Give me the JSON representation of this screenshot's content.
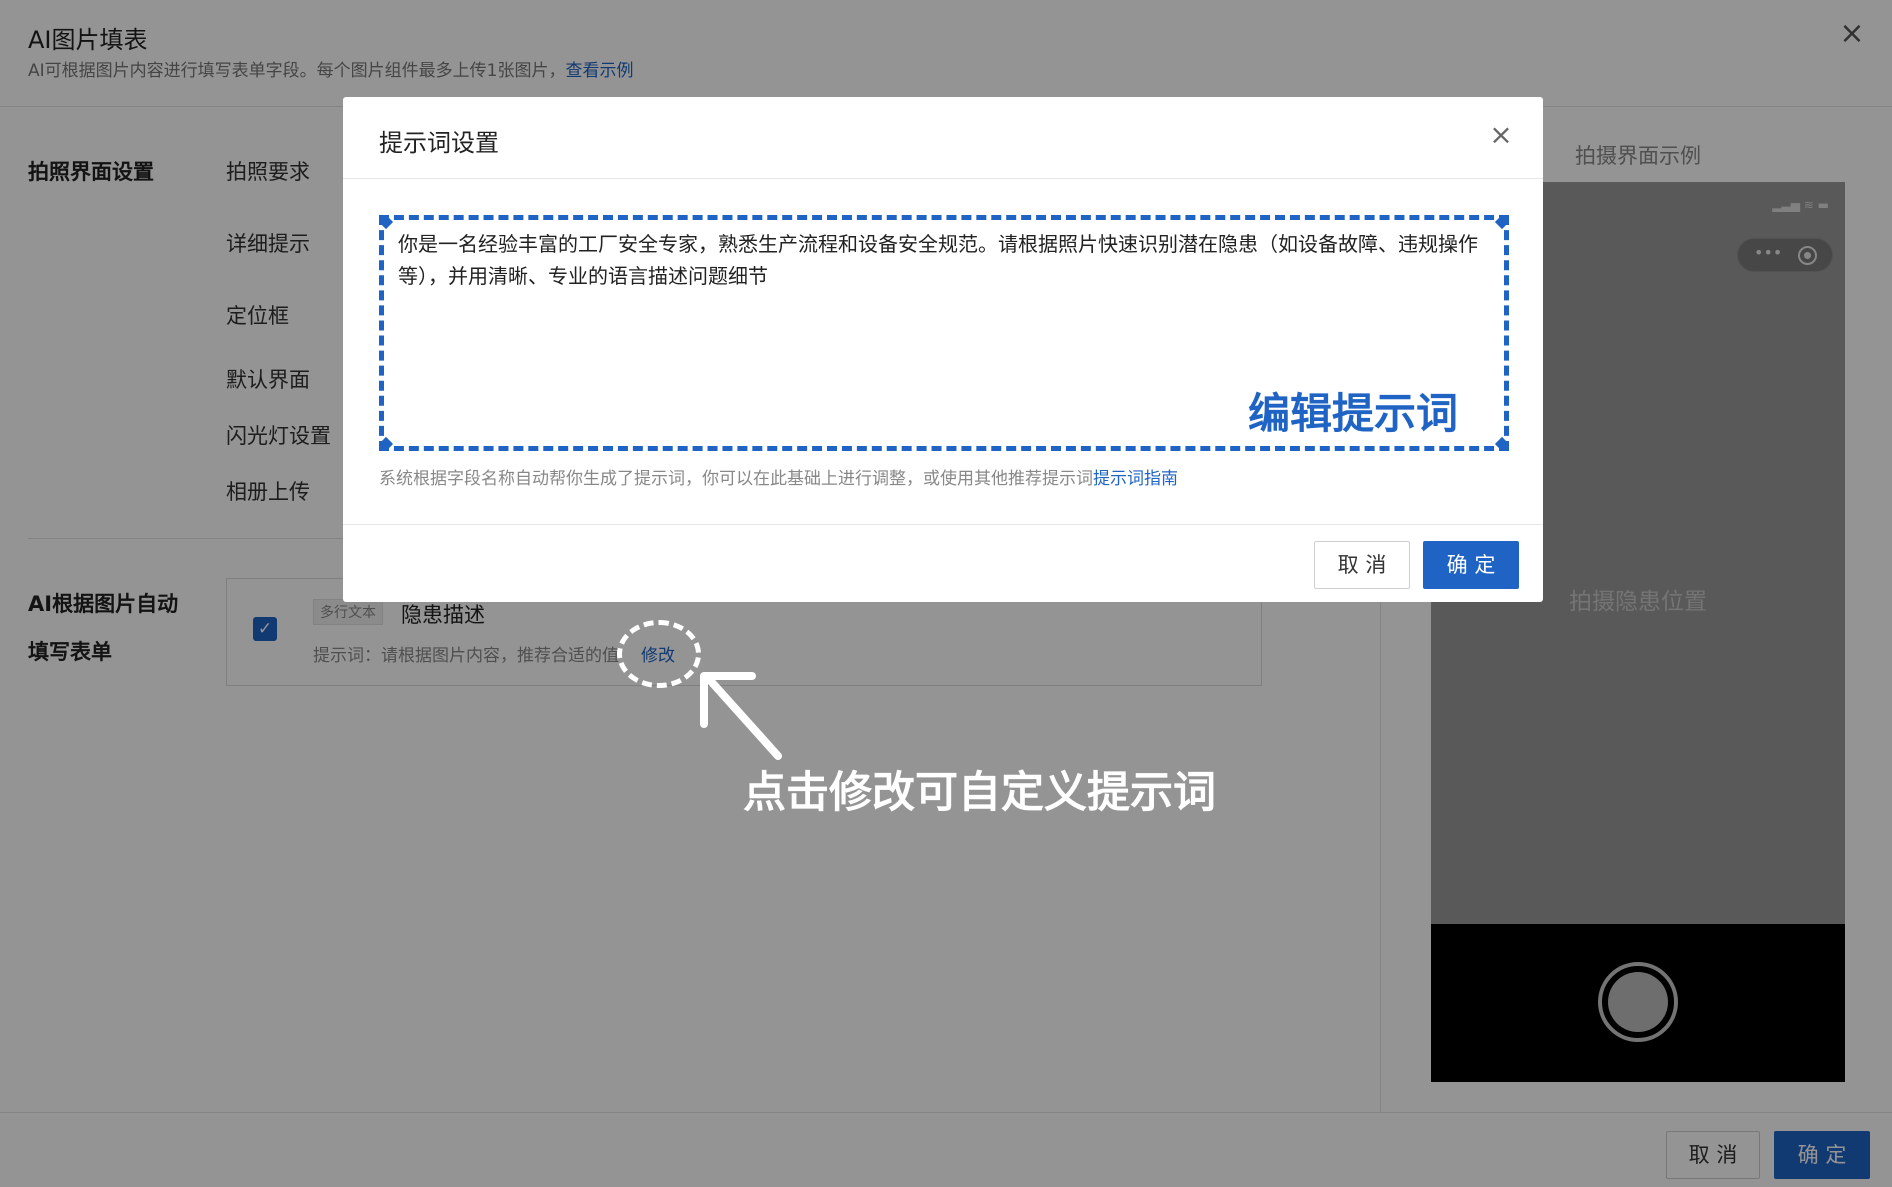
{
  "page": {
    "title": "AI图片填表",
    "subtitle": "AI可根据图片内容进行填写表单字段。每个图片组件最多上传1张图片，",
    "subtitle_link": "查看示例",
    "close_icon": "×"
  },
  "settings": {
    "section_title": "拍照界面设置",
    "rows": [
      "拍照要求",
      "详细提示",
      "定位框",
      "默认界面",
      "闪光灯设置",
      "相册上传"
    ]
  },
  "ai_fill": {
    "section_title_line1": "AI根据图片自动",
    "section_title_line2": "填写表单",
    "checkbox_glyph": "✓",
    "field_type_tag": "多行文本",
    "field_name": "隐患描述",
    "prompt_label": "提示词：请根据图片内容，推荐合适的值",
    "edit_link": "修改"
  },
  "preview": {
    "title": "拍摄界面示例",
    "status_icons": "▂▃▅ ≋ ▬",
    "capsule_dots": "•••",
    "hint": "拍摄隐患位置"
  },
  "footer": {
    "cancel_label": "取 消",
    "confirm_label": "确 定"
  },
  "modal": {
    "title": "提示词设置",
    "close_icon": "×",
    "prompt_value": "你是一名经验丰富的工厂安全专家，熟悉生产流程和设备安全规范。请根据照片快速识别潜在隐患（如设备故障、违规操作等），并用清晰、专业的语言描述问题细节",
    "callout": "编辑提示词",
    "help_text": "系统根据字段名称自动帮你生成了提示词，你可以在此基础上进行调整，或使用其他推荐提示词",
    "help_link": "提示词指南",
    "cancel_label": "取 消",
    "confirm_label": "确 定"
  },
  "annotation": {
    "text": "点击修改可自定义提示词"
  },
  "colors": {
    "primary": "#1f64c4",
    "overlay": "rgba(0,0,0,0.42)"
  }
}
